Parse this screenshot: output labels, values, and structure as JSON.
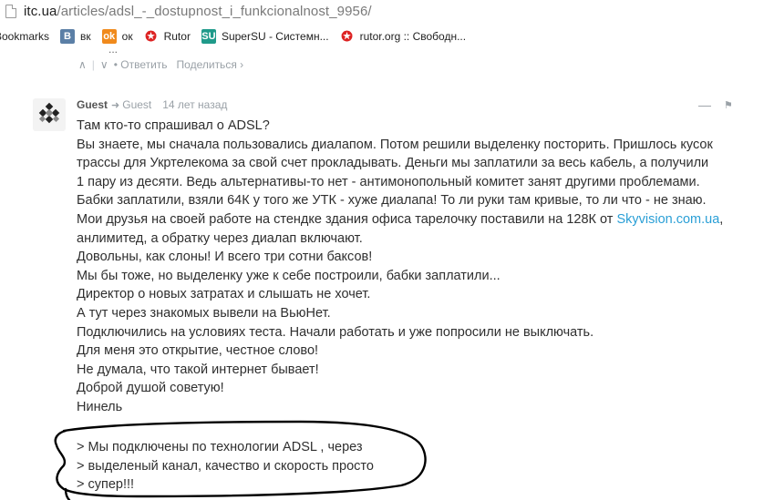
{
  "browser": {
    "url_host": "itc.ua",
    "url_path": "/articles/adsl_-_dostupnost_i_funkcionalnost_9956/"
  },
  "bookmarks": {
    "first": "Bookmarks",
    "items": [
      {
        "label": "вк",
        "icon": "vk-icon",
        "glyph": "B"
      },
      {
        "label": "ок",
        "icon": "ok-icon",
        "glyph": "ok"
      },
      {
        "label": "Rutor",
        "icon": "rutor-icon",
        "glyph": "✪"
      },
      {
        "label": "SuperSU - Системн...",
        "icon": "supersu-icon",
        "glyph": "SU"
      },
      {
        "label": "rutor.org :: Свободн...",
        "icon": "rutor-icon",
        "glyph": "✪"
      }
    ]
  },
  "prev_comment": {
    "cut_text": "...",
    "upvote": "∧",
    "downvote": "∨",
    "reply": "• Ответить",
    "share": "Поделиться ›"
  },
  "comment": {
    "author": "Guest",
    "guest_tag": "Guest",
    "time": "14 лет назад",
    "collapse": "—",
    "flag": "⚑",
    "lines": [
      "Там кто-то спрашивал о ADSL?",
      "Вы знаете, мы сначала пользовались диалапом. Потом решили выделенку посторить. Пришлось кусок",
      "трассы для Укртелекома за свой счет прокладывать. Деньги мы заплатили за весь кабель, а получили",
      "1 пару из десяти. Ведь альтернативы-то нет - антимонопольный комитет занят другими проблемами.",
      "Бабки заплатили, взяли 64К у того же УТК - хуже диалапа! То ли руки там кривые, то ли что - не знаю."
    ],
    "line_link_prefix": "Мои друзья на своей работе на стендке здания офиса тарелочку поставили на 128К от ",
    "link": "Skyvision.com.ua",
    "line_link_suffix": ",",
    "lines2": [
      "анлимитед, а обратку через диалап включают.",
      "Довольны, как слоны! И всего три сотни баксов!",
      "Мы бы тоже, но выделенку уже к себе построили, бабки заплатили...",
      "Директор о новых затратах и слышать не хочет.",
      "А тут через знакомых вывели на ВьюНет.",
      "Подключились на условиях теста. Начали работать и уже попросили не выключать.",
      "Для меня это открытие, честное слово!",
      "Не думала, что такой интернет бывает!",
      "Доброй душой советую!",
      "Нинель"
    ],
    "quote": [
      "> Мы подключены по технологии ADSL , через",
      "> выделеный канал, качество и скорость просто",
      "> супер!!!"
    ]
  }
}
